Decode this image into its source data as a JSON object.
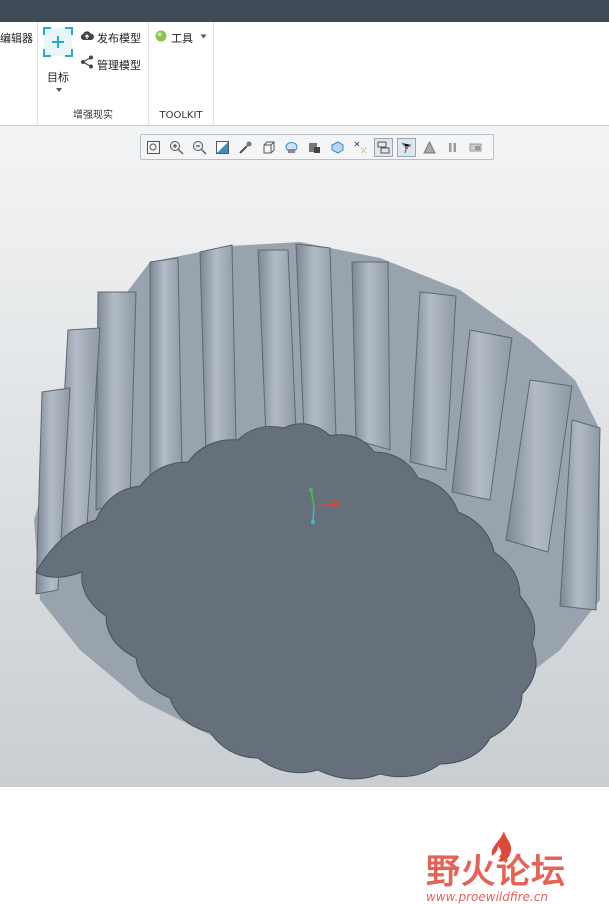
{
  "ribbon": {
    "editor_label": "编辑器",
    "target_label": "目标",
    "publish_label": "发布模型",
    "manage_label": "管理模型",
    "group_ar_label": "增强现实",
    "tools_label": "工具",
    "group_toolkit_label": "TOOLKIT"
  },
  "toolbar_icons": [
    "refit-icon",
    "zoom-in-icon",
    "zoom-out-icon",
    "repaint-icon",
    "perspective-icon",
    "display-style-icon",
    "saved-views-icon",
    "named-view-icon",
    "section-icon",
    "annotation-display-icon",
    "datum-display-icon",
    "spin-center-icon",
    "appearance-icon",
    "pause-icon",
    "fullscreen-icon"
  ],
  "watermark": {
    "title": "野火论坛",
    "url": "www.proewildfire.cn"
  },
  "colors": {
    "titlebar": "#3e4a55",
    "accent": "#29a9c9",
    "gear_face": "#66707a",
    "gear_side": "#a6b0bb",
    "watermark_red": "#e0473a"
  }
}
